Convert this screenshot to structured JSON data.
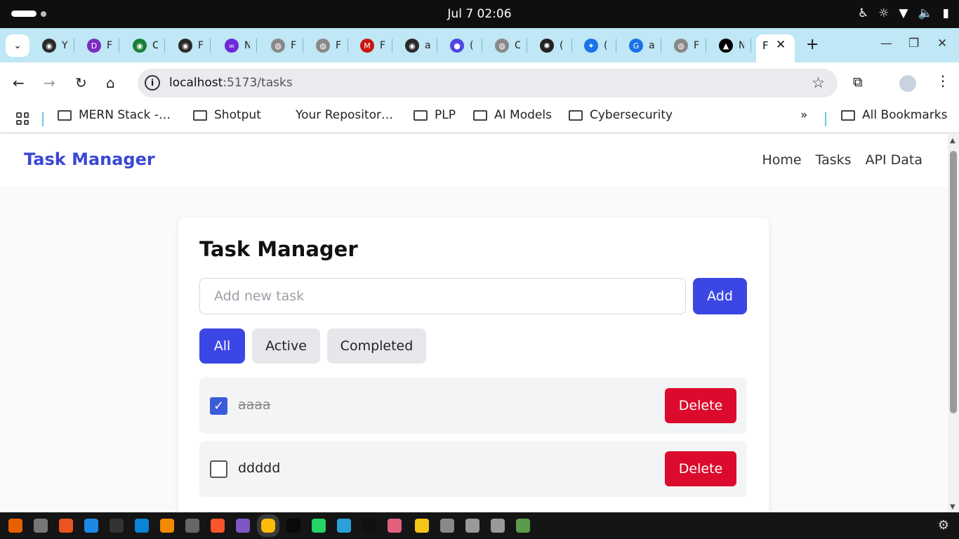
{
  "system": {
    "clock": "Jul 7  02:06"
  },
  "browser": {
    "tabs": [
      {
        "t": "Y",
        "c": "#2a2a2a",
        "g": "◉"
      },
      {
        "t": "F",
        "c": "#7b2cbf",
        "g": "D"
      },
      {
        "t": "C",
        "c": "#1a7f37",
        "g": "◉"
      },
      {
        "t": "F",
        "c": "#2a2a2a",
        "g": "◉"
      },
      {
        "t": "N",
        "c": "#6d28d9",
        "g": "∞"
      },
      {
        "t": "F",
        "c": "#888888",
        "g": "◍"
      },
      {
        "t": "F",
        "c": "#888888",
        "g": "◍"
      },
      {
        "t": "F",
        "c": "#c71610",
        "g": "M"
      },
      {
        "t": "a",
        "c": "#2a2a2a",
        "g": "◉"
      },
      {
        "t": "(",
        "c": "#4f46e5",
        "g": "●"
      },
      {
        "t": "C",
        "c": "#888888",
        "g": "◍"
      },
      {
        "t": "(",
        "c": "#222222",
        "g": "✺"
      },
      {
        "t": "(",
        "c": "#1a73e8",
        "g": "✦"
      },
      {
        "t": "a",
        "c": "#1a73e8",
        "g": "G"
      },
      {
        "t": "F",
        "c": "#888888",
        "g": "◍"
      },
      {
        "t": "N",
        "c": "#000000",
        "g": "▲"
      }
    ],
    "active_tab_title": "F",
    "url_host": "localhost",
    "url_rest": ":5173/tasks"
  },
  "bookmarks": {
    "items": [
      {
        "label": "MERN Stack -…",
        "folder": true
      },
      {
        "label": "Shotput",
        "folder": true
      },
      {
        "label": "Your Repositor…",
        "folder": false
      },
      {
        "label": "PLP",
        "folder": true
      },
      {
        "label": "AI Models",
        "folder": true
      },
      {
        "label": "Cybersecurity",
        "folder": true
      }
    ],
    "overflow": "»",
    "all_label": "All Bookmarks"
  },
  "nav": {
    "brand": "Task Manager",
    "links": [
      "Home",
      "Tasks",
      "API Data"
    ]
  },
  "tasks_page": {
    "title": "Task Manager",
    "input_placeholder": "Add new task",
    "input_value": "",
    "add_label": "Add",
    "filters": [
      {
        "label": "All",
        "active": true
      },
      {
        "label": "Active",
        "active": false
      },
      {
        "label": "Completed",
        "active": false
      }
    ],
    "tasks": [
      {
        "text": "aaaa",
        "completed": true,
        "delete_label": "Delete"
      },
      {
        "text": "ddddd",
        "completed": false,
        "delete_label": "Delete"
      }
    ]
  },
  "colors": {
    "accent": "#3b47e5",
    "danger": "#dc0a2d",
    "tab_strip": "#bfe7f5"
  },
  "taskbar_apps": [
    {
      "name": "firefox",
      "c": "#e66000"
    },
    {
      "name": "files",
      "c": "#777777"
    },
    {
      "name": "software",
      "c": "#e95420"
    },
    {
      "name": "help",
      "c": "#1e88e5"
    },
    {
      "name": "terminal",
      "c": "#333333"
    },
    {
      "name": "vscode",
      "c": "#0a84d6"
    },
    {
      "name": "vlc",
      "c": "#f08a00"
    },
    {
      "name": "settings",
      "c": "#666666"
    },
    {
      "name": "brave",
      "c": "#fb542b"
    },
    {
      "name": "app",
      "c": "#7e57c2"
    },
    {
      "name": "chrome",
      "c": "#fbbc05"
    },
    {
      "name": "mongodb",
      "c": "#0a0a0a"
    },
    {
      "name": "whatsapp",
      "c": "#25d366"
    },
    {
      "name": "telegram",
      "c": "#2aa1da"
    },
    {
      "name": "github",
      "c": "#111111"
    },
    {
      "name": "pie",
      "c": "#e0607e"
    },
    {
      "name": "notes",
      "c": "#f5c518"
    },
    {
      "name": "doc",
      "c": "#888888"
    },
    {
      "name": "disk",
      "c": "#999999"
    },
    {
      "name": "disk2",
      "c": "#999999"
    },
    {
      "name": "trash",
      "c": "#5b9b4b"
    }
  ]
}
